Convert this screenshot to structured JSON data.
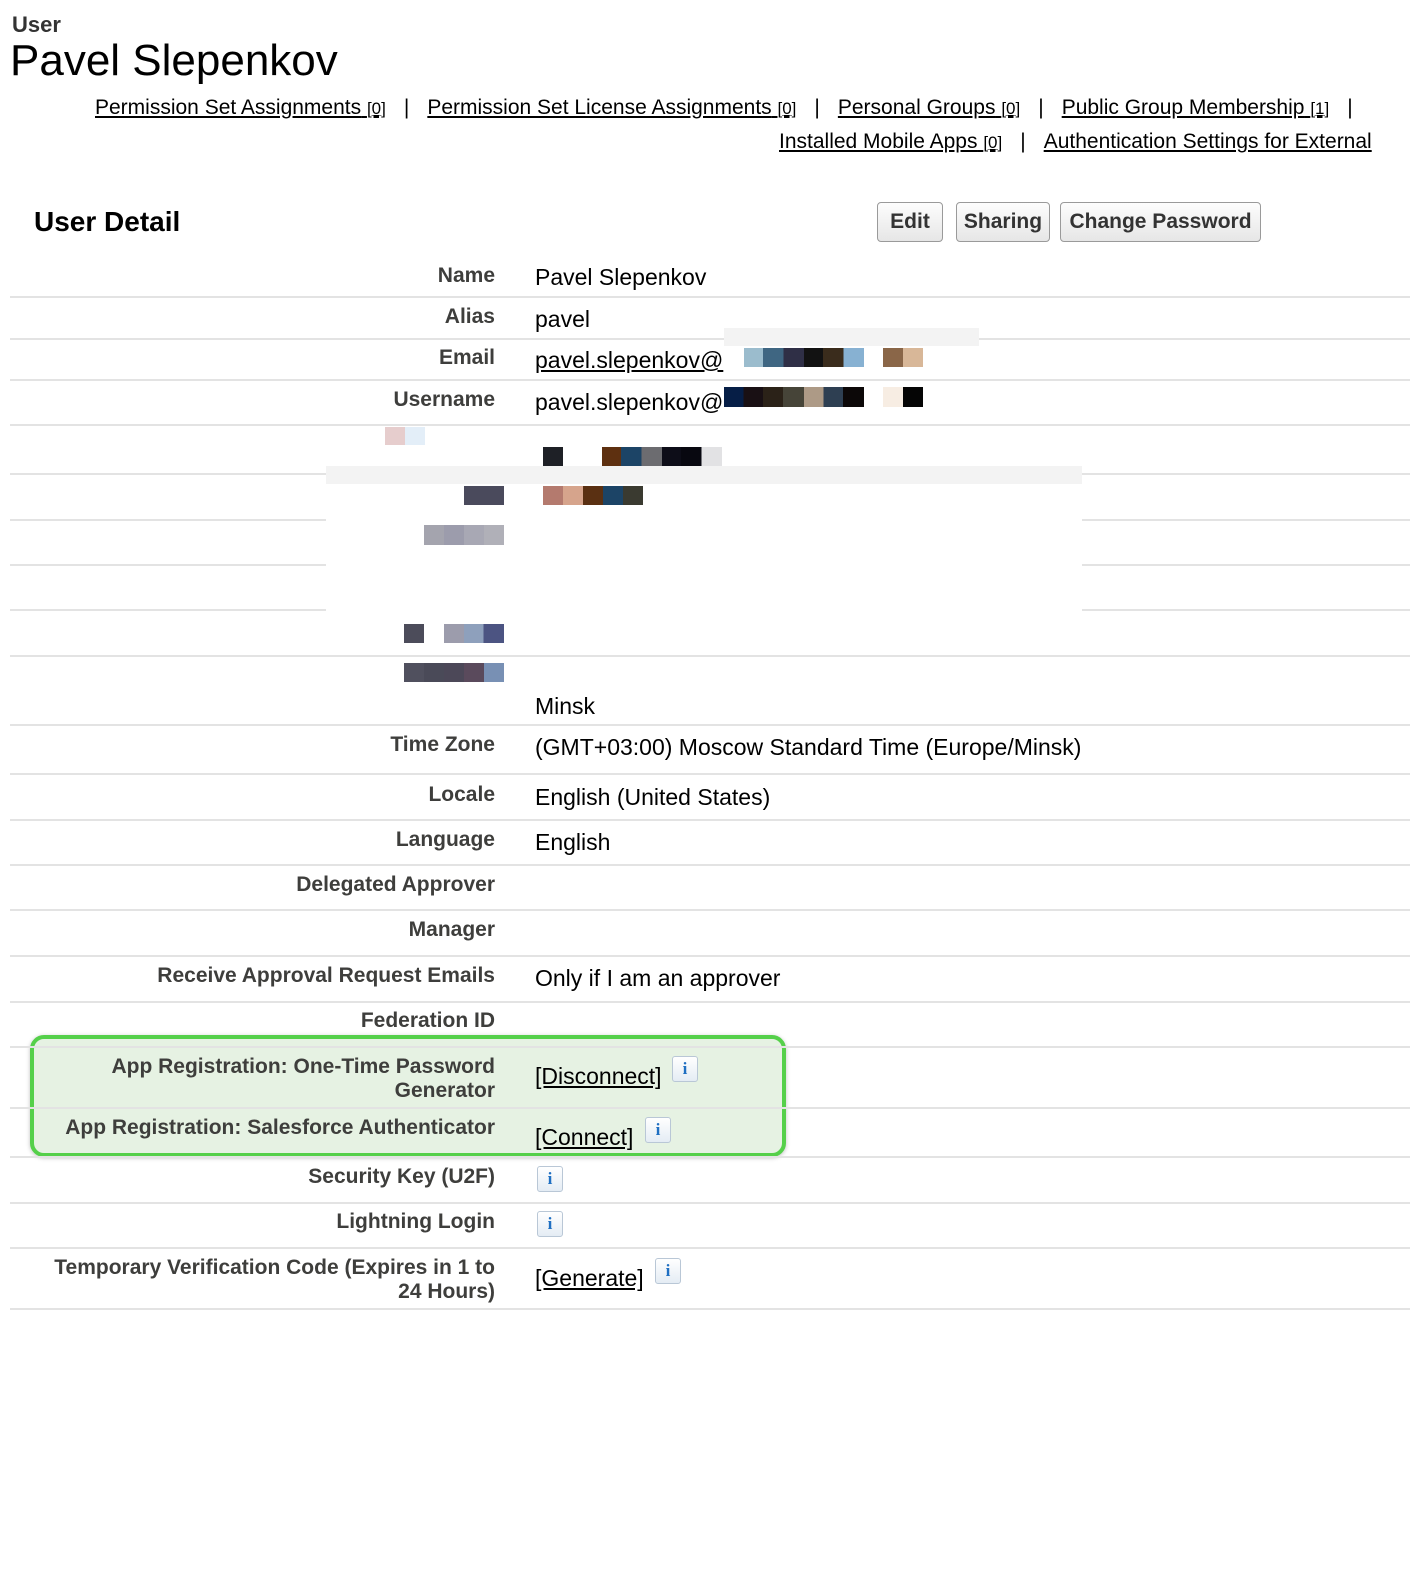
{
  "header": {
    "object_type": "User",
    "title": "Pavel Slepenkov"
  },
  "related_links": {
    "row1": [
      {
        "label": "Permission Set Assignments",
        "count": "[0]"
      },
      {
        "label": "Permission Set License Assignments",
        "count": "[0]"
      },
      {
        "label": "Personal Groups",
        "count": "[0]"
      },
      {
        "label": "Public Group Membership",
        "count": "[1]"
      }
    ],
    "row2": [
      {
        "label": "Installed Mobile Apps",
        "count": "[0]"
      },
      {
        "label": "Authentication Settings for External"
      }
    ],
    "separator": "|"
  },
  "detail": {
    "section_title": "User Detail",
    "buttons": {
      "edit": "Edit",
      "sharing": "Sharing",
      "change_password": "Change Password"
    },
    "fields": {
      "name": {
        "label": "Name",
        "value": "Pavel Slepenkov"
      },
      "alias": {
        "label": "Alias",
        "value": "pavel"
      },
      "email": {
        "label": "Email",
        "value": "pavel.slepenkov@"
      },
      "username": {
        "label": "Username",
        "value": "pavel.slepenkov@"
      },
      "city": {
        "value": "Minsk"
      },
      "time_zone": {
        "label": "Time Zone",
        "value": "(GMT+03:00) Moscow Standard Time (Europe/Minsk)"
      },
      "locale": {
        "label": "Locale",
        "value": "English (United States)"
      },
      "language": {
        "label": "Language",
        "value": "English"
      },
      "delegated_approver": {
        "label": "Delegated Approver",
        "value": ""
      },
      "manager": {
        "label": "Manager",
        "value": ""
      },
      "approval_emails": {
        "label": "Receive Approval Request Emails",
        "value": "Only if I am an approver"
      },
      "federation_id": {
        "label": "Federation ID",
        "value": ""
      },
      "otp_generator": {
        "label_line1": "App Registration: One-Time Password",
        "label_line2": "Generator",
        "action": "[Disconnect]"
      },
      "salesforce_authenticator": {
        "label": "App Registration: Salesforce Authenticator",
        "action": "[Connect]"
      },
      "security_key": {
        "label": "Security Key (U2F)"
      },
      "lightning_login": {
        "label": "Lightning Login"
      },
      "temp_code": {
        "label_line1": "Temporary Verification Code (Expires in 1 to",
        "label_line2": "24 Hours)",
        "action": "[Generate]"
      }
    },
    "info_icon_glyph": "i"
  },
  "colors": {
    "highlight_border": "#55d04a",
    "highlight_fill": "#e6f2e3",
    "info_icon": "#1f6fc2",
    "label_text": "#3e3e3c"
  }
}
